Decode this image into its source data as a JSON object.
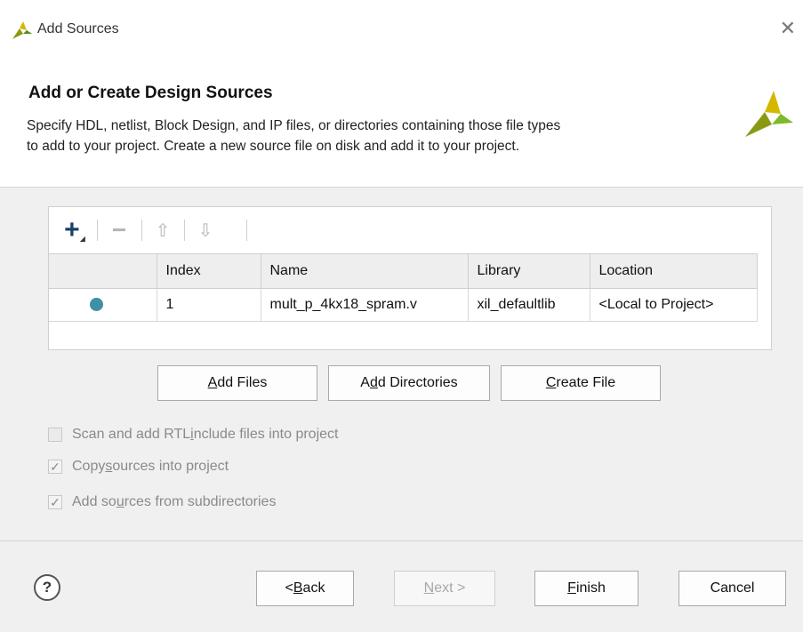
{
  "window": {
    "title": "Add Sources"
  },
  "header": {
    "title": "Add or Create Design Sources",
    "description": "Specify HDL, netlist, Block Design, and IP files, or directories containing those file types\nto add to your project. Create a new source file on disk and add it to your project."
  },
  "toolbar": {
    "add": "+",
    "remove": "−",
    "move_up": "⇧",
    "move_down": "⇩"
  },
  "table": {
    "columns": [
      "",
      "Index",
      "Name",
      "Library",
      "Location"
    ],
    "rows": [
      {
        "index": "1",
        "name": "mult_p_4kx18_spram.v",
        "library": "xil_defaultlib",
        "location": "<Local to Project>"
      }
    ]
  },
  "buttons": {
    "add_files": {
      "pre": "",
      "ul": "A",
      "post": "dd Files"
    },
    "add_directories": {
      "pre": "A",
      "ul": "d",
      "post": "d Directories"
    },
    "create_file": {
      "pre": "",
      "ul": "C",
      "post": "reate File"
    }
  },
  "options": [
    {
      "pre": "Scan and add RTL ",
      "ul": "i",
      "post": "nclude files into project",
      "checked": false
    },
    {
      "pre": "Copy ",
      "ul": "s",
      "post": "ources into project",
      "checked": true
    },
    {
      "pre": "Add so",
      "ul": "u",
      "post": "rces from subdirectories",
      "checked": true
    }
  ],
  "footer": {
    "help": "?",
    "back": {
      "pre": "< ",
      "ul": "B",
      "post": "ack"
    },
    "next": {
      "pre": "",
      "ul": "N",
      "post": "ext >"
    },
    "finish": {
      "pre": "",
      "ul": "F",
      "post": "inish"
    },
    "cancel": "Cancel"
  },
  "colors": {
    "status_dot": "#3f8fa6",
    "logo_yellow": "#c9b900",
    "logo_green": "#5a8a1e"
  }
}
